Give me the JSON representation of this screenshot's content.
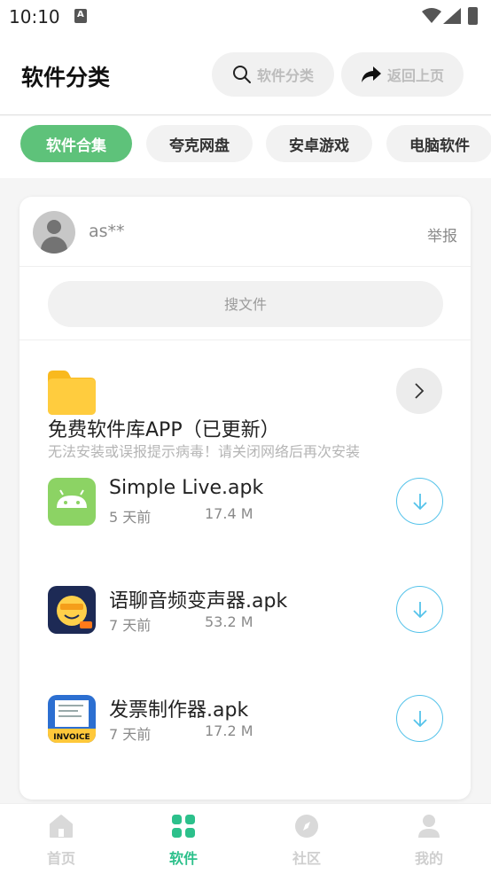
{
  "status_bar": {
    "time": "10:10"
  },
  "header": {
    "title": "软件分类",
    "search_button": "软件分类",
    "back_button": "返回上页"
  },
  "tabs": [
    {
      "label": "软件合集",
      "active": true
    },
    {
      "label": "夸克网盘",
      "active": false
    },
    {
      "label": "安卓游戏",
      "active": false
    },
    {
      "label": "电脑软件",
      "active": false
    }
  ],
  "card": {
    "user_name": "as**",
    "report_label": "举报",
    "search_placeholder": "搜文件",
    "folder": {
      "title": "免费软件库APP（已更新）",
      "description": "无法安装或误报提示病毒！请关闭网络后再次安装"
    },
    "files": [
      {
        "name": "Simple Live.apk",
        "date": "5 天前",
        "size": "17.4 M",
        "icon": "android-icon"
      },
      {
        "name": "语聊音频变声器.apk",
        "date": "7 天前",
        "size": "53.2 M",
        "icon": "voice-changer-app-icon"
      },
      {
        "name": "发票制作器.apk",
        "date": "7 天前",
        "size": "17.2 M",
        "icon": "invoice-app-icon",
        "icon_text": "INVOICE"
      }
    ]
  },
  "bottom_nav": [
    {
      "label": "首页",
      "icon": "home-icon",
      "active": false
    },
    {
      "label": "软件",
      "icon": "grid-icon",
      "active": true
    },
    {
      "label": "社区",
      "icon": "compass-icon",
      "active": false
    },
    {
      "label": "我的",
      "icon": "user-icon",
      "active": false
    }
  ],
  "colors": {
    "accent_green": "#5ec27a",
    "nav_active": "#2cc08b",
    "download_blue": "#55c3ea"
  }
}
